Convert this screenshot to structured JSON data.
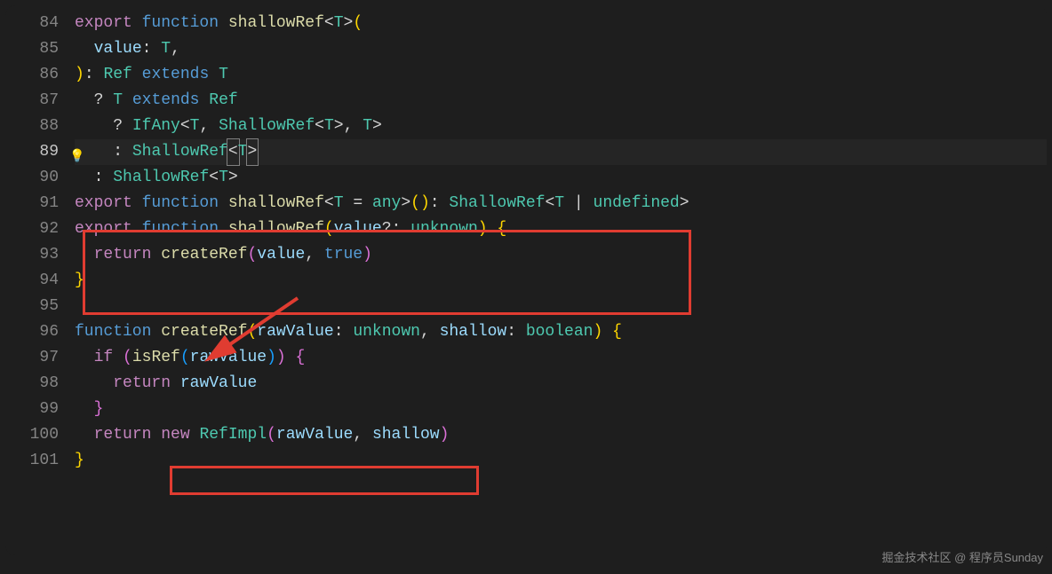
{
  "lineNumbers": [
    "84",
    "85",
    "86",
    "87",
    "88",
    "89",
    "90",
    "91",
    "92",
    "93",
    "94",
    "95",
    "96",
    "97",
    "98",
    "99",
    "100",
    "101"
  ],
  "activeLine": "89",
  "code": {
    "l84": {
      "export": "export",
      "function": "function",
      "name": "shallowRef",
      "lt": "<",
      "T": "T",
      "gt": ">",
      "lp": "("
    },
    "l85": {
      "indent": "  ",
      "param": "value",
      "colon": ":",
      "sp": " ",
      "T": "T",
      "comma": ","
    },
    "l86": {
      "rp": ")",
      "colon": ":",
      "sp": " ",
      "Ref": "Ref",
      "sp2": " ",
      "extends": "extends",
      "sp3": " ",
      "T": "T"
    },
    "l87": {
      "indent": "  ",
      "q": "?",
      "sp": " ",
      "T": "T",
      "sp2": " ",
      "extends": "extends",
      "sp3": " ",
      "Ref": "Ref"
    },
    "l88": {
      "indent": "    ",
      "q": "?",
      "sp": " ",
      "IfAny": "IfAny",
      "lt": "<",
      "T1": "T",
      "c1": ",",
      "sp2": " ",
      "ShallowRef": "ShallowRef",
      "lt2": "<",
      "T2": "T",
      "gt2": ">",
      "c2": ",",
      "sp3": " ",
      "T3": "T",
      "gt": ">"
    },
    "l89": {
      "indent": "    ",
      "colon": ":",
      "sp": " ",
      "ShallowRef": "ShallowRef",
      "lt": "<",
      "T": "T",
      "gt": ">"
    },
    "l90": {
      "indent": "  ",
      "colon": ":",
      "sp": " ",
      "ShallowRef": "ShallowRef",
      "lt": "<",
      "T": "T",
      "gt": ">"
    },
    "l91": {
      "export": "export",
      "function": "function",
      "name": "shallowRef",
      "lt": "<",
      "T": "T",
      "sp": " ",
      "eq": "=",
      "sp2": " ",
      "any": "any",
      "gt": ">",
      "lp": "(",
      "rp": ")",
      "colon": ":",
      "sp3": " ",
      "ShallowRef": "ShallowRef",
      "lt2": "<",
      "T2": "T",
      "sp4": " ",
      "pipe": "|",
      "sp5": " ",
      "undef": "undefined",
      "gt2": ">"
    },
    "l92": {
      "export": "export",
      "function": "function",
      "name": "shallowRef",
      "lp": "(",
      "param": "value",
      "q": "?",
      "colon": ":",
      "sp": " ",
      "unknown": "unknown",
      "rp": ")",
      "sp2": " ",
      "lb": "{"
    },
    "l93": {
      "indent": "  ",
      "return": "return",
      "sp": " ",
      "fn": "createRef",
      "lp": "(",
      "p1": "value",
      "c": ",",
      "sp2": " ",
      "true": "true",
      "rp": ")"
    },
    "l94": {
      "rb": "}"
    },
    "l96": {
      "function": "function",
      "name": "createRef",
      "lp": "(",
      "p1": "rawValue",
      "colon1": ":",
      "sp1": " ",
      "t1": "unknown",
      "c": ",",
      "sp2": " ",
      "p2": "shallow",
      "colon2": ":",
      "sp3": " ",
      "t2": "boolean",
      "rp": ")",
      "sp4": " ",
      "lb": "{"
    },
    "l97": {
      "indent": "  ",
      "if": "if",
      "sp": " ",
      "lp": "(",
      "fn": "isRef",
      "lp2": "(",
      "p": "rawValue",
      "rp2": ")",
      "rp": ")",
      "sp2": " ",
      "lb": "{"
    },
    "l98": {
      "indent": "    ",
      "return": "return",
      "sp": " ",
      "p": "rawValue"
    },
    "l99": {
      "indent": "  ",
      "rb": "}"
    },
    "l100": {
      "indent": "  ",
      "return": "return",
      "sp": " ",
      "new": "new",
      "sp2": " ",
      "cls": "RefImpl",
      "lp": "(",
      "p1": "rawValue",
      "c": ",",
      "sp3": " ",
      "p2": "shallow",
      "rp": ")"
    },
    "l101": {
      "rb": "}"
    }
  },
  "watermark": "掘金技术社区 @ 程序员Sunday"
}
